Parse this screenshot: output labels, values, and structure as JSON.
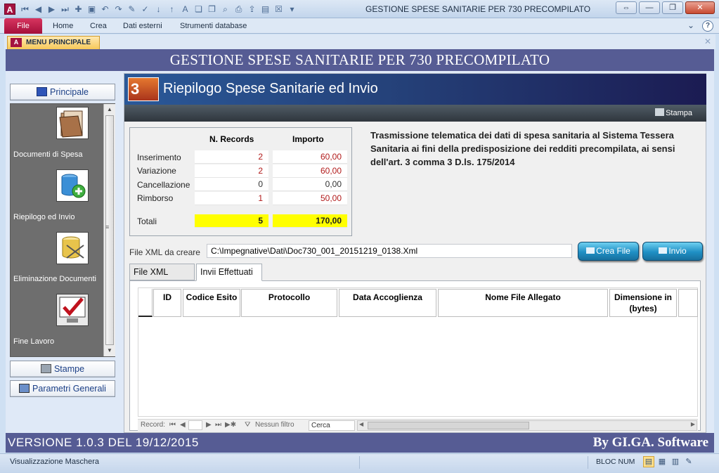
{
  "window": {
    "title": "GESTIONE SPESE SANITARIE PER 730 PRECOMPILATO",
    "app_icon": "A",
    "controls": [
      "⇔",
      "—",
      "❐",
      "✕"
    ]
  },
  "ribbon": {
    "file_label": "File",
    "tabs": [
      "Home",
      "Crea",
      "Dati esterni",
      "Strumenti database"
    ]
  },
  "document_tab": {
    "label": "MENU PRINCIPALE",
    "icon": "A"
  },
  "form": {
    "header": "GESTIONE SPESE SANITARIE PER 730 PRECOMPILATO",
    "version": "VERSIONE 1.0.3 DEL 19/12/2015",
    "brand": "By GI.GA. Software"
  },
  "nav": {
    "principale": "Principale",
    "items": [
      {
        "label": "Documenti di Spesa",
        "icon": "folder-icon"
      },
      {
        "label": "Riepilogo ed Invio",
        "icon": "database-add-icon"
      },
      {
        "label": "Eliminazione Documenti",
        "icon": "database-delete-icon"
      },
      {
        "label": "Fine Lavoro",
        "icon": "checkmark-monitor-icon"
      }
    ],
    "stampe": "Stampe",
    "parametri": "Parametri Generali"
  },
  "banner": {
    "title": "Riepilogo Spese Sanitarie ed Invio",
    "logo": "3"
  },
  "stampa_label": "Stampa",
  "summary": {
    "headers": {
      "records": "N. Records",
      "importo": "Importo"
    },
    "rows": [
      {
        "label": "Inserimento",
        "records": "2",
        "importo": "60,00"
      },
      {
        "label": "Variazione",
        "records": "2",
        "importo": "60,00"
      },
      {
        "label": "Cancellazione",
        "records": "0",
        "importo": "0,00"
      },
      {
        "label": "Rimborso",
        "records": "1",
        "importo": "50,00"
      }
    ],
    "totals": {
      "label": "Totali",
      "records": "5",
      "importo": "170,00"
    }
  },
  "description": "Trasmissione telematica dei dati di spesa sanitaria al Sistema Tessera Sanitaria ai fini della predisposizione dei redditi precompilata, ai sensi dell'art. 3 comma 3 D.ls. 175/2014",
  "xml": {
    "label": "File XML da creare",
    "value": "C:\\Impegnative\\Dati\\Doc730_001_20151219_0138.Xml"
  },
  "buttons": {
    "crea_file": "Crea File",
    "invio": "Invio"
  },
  "tabs": [
    "File XML Creati",
    "Invii Effettuati"
  ],
  "grid": {
    "columns": [
      "ID",
      "Codice Esito",
      "Protocollo",
      "Data Accoglienza",
      "Nome File Allegato",
      "Dimensione in (bytes)"
    ]
  },
  "recnav": {
    "record_label": "Record:",
    "filter_label": "Nessun filtro",
    "search_label": "Cerca"
  },
  "status": {
    "text": "Visualizzazione Maschera",
    "bloc_num": "BLOC NUM"
  },
  "colors": {
    "form_frame": "#565c94",
    "banner_gradient": [
      "#2a5898",
      "#1b1b52"
    ],
    "totals_highlight": "#ffff00",
    "value_red": "#b11a1a",
    "button_blue": "#1f8fc4",
    "file_tab": "#a50f3b"
  }
}
